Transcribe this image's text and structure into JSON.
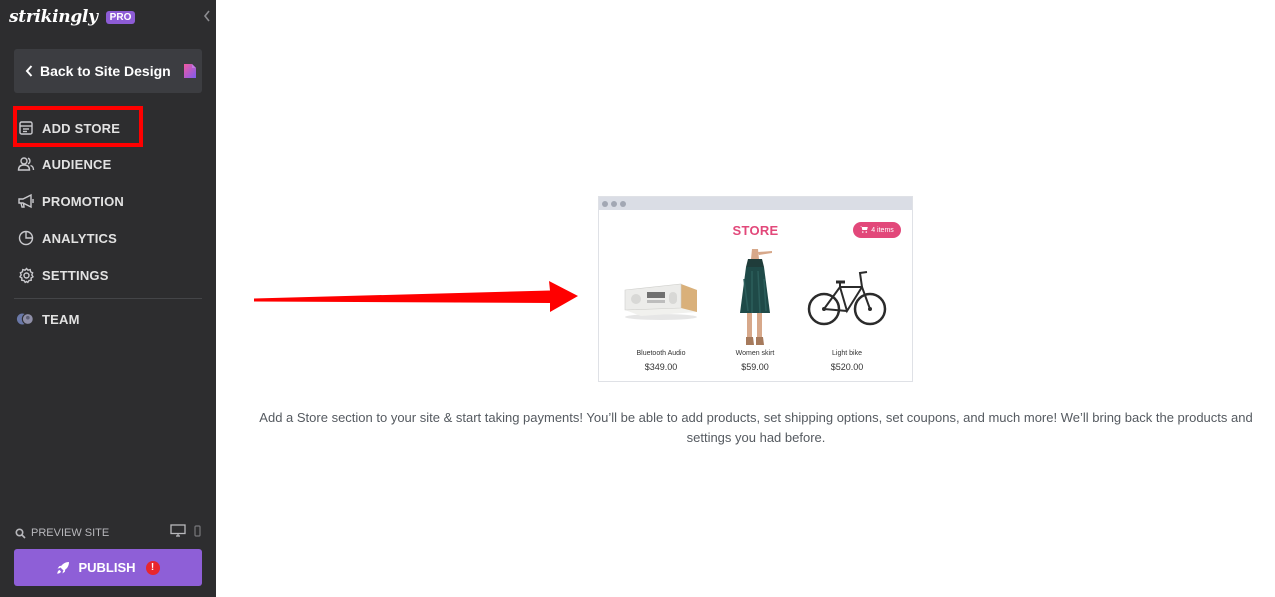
{
  "app": {
    "logo_text": "strikingly",
    "plan_badge": "PRO"
  },
  "sidebar": {
    "back_button_label": "Back to Site Design",
    "items": [
      {
        "label": "ADD STORE",
        "icon": "store-icon"
      },
      {
        "label": "AUDIENCE",
        "icon": "users-icon"
      },
      {
        "label": "PROMOTION",
        "icon": "megaphone-icon"
      },
      {
        "label": "ANALYTICS",
        "icon": "pie-chart-icon"
      },
      {
        "label": "SETTINGS",
        "icon": "gear-icon"
      },
      {
        "label": "TEAM",
        "icon": "team-avatars-icon"
      }
    ],
    "preview_label": "PREVIEW SITE",
    "publish_label": "PUBLISH",
    "publish_alert": "!"
  },
  "main": {
    "store_preview": {
      "title": "STORE",
      "cart_label": "4 items",
      "products": [
        {
          "name": "Bluetooth Audio",
          "price": "$349.00"
        },
        {
          "name": "Women skirt",
          "price": "$59.00"
        },
        {
          "name": "Light bike",
          "price": "$520.00"
        }
      ]
    },
    "description": "Add a Store section to your site & start taking payments! You’ll be able to add products, set shipping options, set coupons, and much more! We’ll bring back the products and settings you had before."
  },
  "colors": {
    "sidebar_bg": "#2d2d2f",
    "accent_purple": "#8e5fd7",
    "store_pink": "#e2487a",
    "annotation_red": "#ff0000"
  }
}
